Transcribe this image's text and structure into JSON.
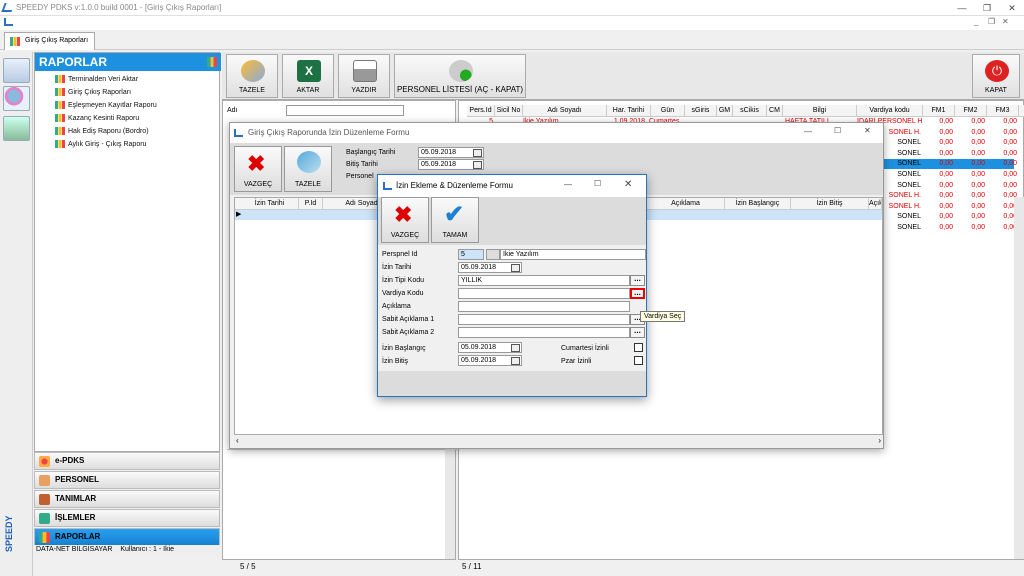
{
  "window": {
    "title": "SPEEDY PDKS v:1.0.0 build 0001 - [Giriş Çıkış Raporları]"
  },
  "tab": {
    "label": "Giriş Çıkış Raporları"
  },
  "reports": {
    "header": "RAPORLAR",
    "items": [
      "Terminalden Veri Aktar",
      "Giriş Çıkış Raporları",
      "Eşleşmeyen Kayıtlar Raporu",
      "Kazanç Kesinti Raporu",
      "Hak Ediş Raporu (Bordro)",
      "Aylık Giriş - Çıkış Raporu"
    ]
  },
  "nav": [
    "e-PDKS",
    "PERSONEL",
    "TANIMLAR",
    "İŞLEMLER",
    "RAPORLAR"
  ],
  "status": {
    "pc": "DATA-NET BİLGİSAYAR",
    "user": "Kullanıcı : 1 - Ikie"
  },
  "toolbar": {
    "tazele": "TAZELE",
    "aktar": "AKTAR",
    "yazdir": "YAZDIR",
    "personel": "PERSONEL LİSTESİ (AÇ - KAPAT)",
    "kapat": "KAPAT"
  },
  "left_form": {
    "adi_label": "Adı"
  },
  "grid": {
    "headers": [
      "Pers.Id",
      "Sicil No",
      "Adı Soyadı",
      "Har. Tarihi",
      "Gün",
      "sGiris",
      "GM",
      "sCikis",
      "CM",
      "Bilgi",
      "Vardiya kodu",
      "FM1",
      "FM2",
      "FM3"
    ],
    "first_row": {
      "id": "5",
      "name": "İkie Yazılım",
      "date": "1.09.2018",
      "day": "Cumartesi",
      "info": "HAFTA TATİLİ"
    },
    "vardiya": [
      "İDARİ PERSONEL H.",
      "SONEL H.",
      "SONEL",
      "SONEL",
      "SONEL",
      "SONEL",
      "SONEL",
      "SONEL H.",
      "SONEL H.",
      "SONEL",
      "SONEL"
    ],
    "fm_rows": [
      [
        "0,00",
        "0,00",
        "0,00"
      ],
      [
        "0,00",
        "0,00",
        "0,00"
      ],
      [
        "0,00",
        "0,00",
        "0,00"
      ],
      [
        "0,00",
        "0,00",
        "0,00"
      ],
      [
        "0,00",
        "0,00",
        "0,00"
      ],
      [
        "0,00",
        "0,00",
        "0,00"
      ],
      [
        "0,00",
        "0,00",
        "0,00"
      ],
      [
        "0,00",
        "0,00",
        "0,00"
      ],
      [
        "0,00",
        "0,00",
        "0,00"
      ],
      [
        "0,00",
        "0,00",
        "0,00"
      ],
      [
        "0,00",
        "0,00",
        "0,00"
      ]
    ]
  },
  "footer": {
    "left": "5 / 5",
    "right": "5 / 11"
  },
  "dlg1": {
    "title": "Giriş Çıkış Raporunda İzin Düzenleme Formu",
    "vazgec": "VAZGEÇ",
    "tazele": "TAZELE",
    "baslangic_label": "Başlangıç Tarihi",
    "baslangic": "05.09.2018",
    "bitis_label": "Bitiş Tarihi",
    "bitis": "05.09.2018",
    "personel_label": "Personel",
    "cols": [
      "İzin Tarihi",
      "P.Id",
      "Adı Soyadı",
      "Açıklama",
      "İzin Başlangıç",
      "İzin Bitiş",
      "Açıkl"
    ]
  },
  "dlg2": {
    "title": "İzin Ekleme & Düzenleme Formu",
    "vazgec": "VAZGEÇ",
    "tamam": "TAMAM",
    "personel_id_label": "Perspnel Id",
    "personel_id": "5",
    "personel_name": "Ikie Yazılım",
    "izin_tarihi_label": "İzin Tarihi",
    "izin_tarihi": "05.09.2018",
    "izin_tipi_label": "İzin Tipi Kodu",
    "izin_tipi": "YILLIK",
    "vardiya_label": "Vardiya Kodu",
    "aciklama_label": "Açıklama",
    "sabit1_label": "Sabit Açıklama 1",
    "sabit2_label": "Sabit Açıklama 2",
    "izin_bas_label": "İzin Başlangıç",
    "izin_bas": "05.09.2018",
    "izin_bit_label": "İzin Bitiş",
    "izin_bit": "05.09.2018",
    "cumartesi_label": "Cumartesi İzinli",
    "pazar_label": "Pzar İzinli",
    "tooltip": "Vardiya Seç"
  },
  "colors": {
    "accent": "#1e90e0",
    "danger": "#d00000"
  }
}
